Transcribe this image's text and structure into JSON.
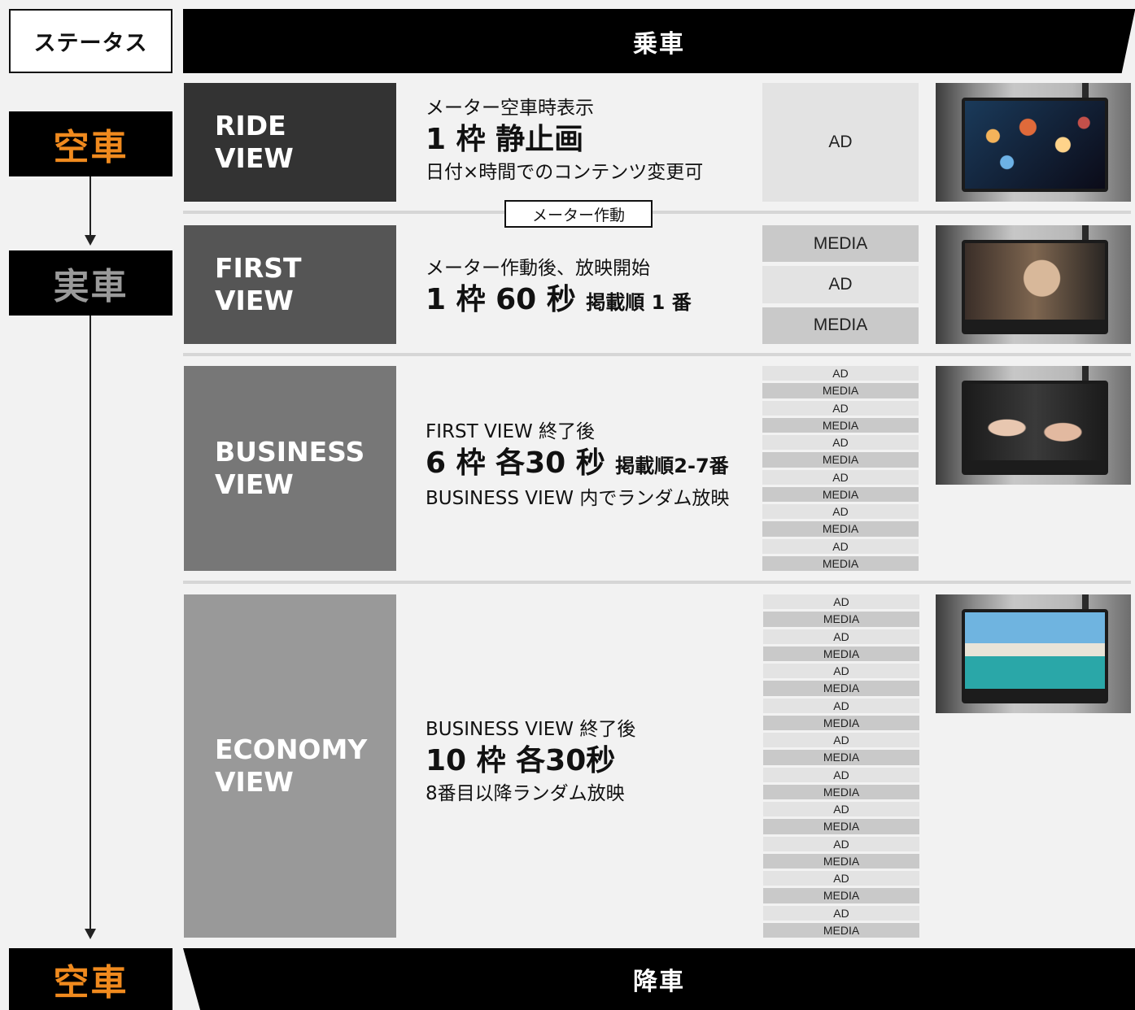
{
  "status": {
    "header": "ステータス",
    "states": [
      "空車",
      "実車",
      "空車"
    ]
  },
  "banners": {
    "top": "乗車",
    "bottom": "降車"
  },
  "meter_badge": "メーター作動",
  "sections": [
    {
      "title_l1": "RIDE",
      "title_l2": "VIEW",
      "bg": "#333333",
      "line1": "メーター空車時表示",
      "big_main": "1 枠 静止画",
      "big_small": "",
      "line3": "日付×時間でのコンテンツ変更可",
      "slots": [
        "AD"
      ]
    },
    {
      "title_l1": "FIRST",
      "title_l2": "VIEW",
      "bg": "#555555",
      "line1": "メーター作動後、放映開始",
      "big_main": "1 枠 60 秒",
      "big_small": "掲載順 1 番",
      "line3": "",
      "slots": [
        "MEDIA",
        "AD",
        "MEDIA"
      ]
    },
    {
      "title_l1": "BUSINESS",
      "title_l2": "VIEW",
      "bg": "#777777",
      "line1": "FIRST VIEW 終了後",
      "big_main": "6 枠 各30 秒",
      "big_small": "掲載順2-7番",
      "line3": "BUSINESS VIEW 内でランダム放映",
      "slots": [
        "AD",
        "MEDIA",
        "AD",
        "MEDIA",
        "AD",
        "MEDIA",
        "AD",
        "MEDIA",
        "AD",
        "MEDIA",
        "AD",
        "MEDIA"
      ]
    },
    {
      "title_l1": "ECONOMY",
      "title_l2": "VIEW",
      "bg": "#999999",
      "line1": "BUSINESS VIEW 終了後",
      "big_main": "10 枠 各30秒",
      "big_small": "",
      "line3": "8番目以降ランダム放映",
      "slots": [
        "AD",
        "MEDIA",
        "AD",
        "MEDIA",
        "AD",
        "MEDIA",
        "AD",
        "MEDIA",
        "AD",
        "MEDIA",
        "AD",
        "MEDIA",
        "AD",
        "MEDIA",
        "AD",
        "MEDIA",
        "AD",
        "MEDIA",
        "AD",
        "MEDIA"
      ]
    }
  ]
}
